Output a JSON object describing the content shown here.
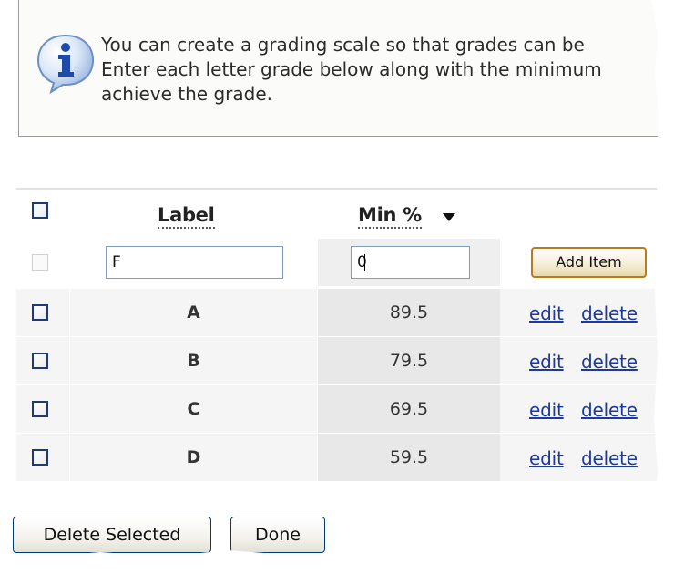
{
  "info": {
    "line1": "You can create a grading scale so that grades can be",
    "line2": "Enter each letter grade below along with the minimum",
    "line3": "achieve the grade.",
    "icon": "info-icon"
  },
  "table": {
    "col_label_header": "Label",
    "col_min_header": "Min %",
    "new_row": {
      "label_value": "F",
      "min_value": "0",
      "add_button": "Add Item"
    },
    "rows": [
      {
        "label": "A",
        "min": "89.5",
        "edit": "edit",
        "delete": "delete"
      },
      {
        "label": "B",
        "min": "79.5",
        "edit": "edit",
        "delete": "delete"
      },
      {
        "label": "C",
        "min": "69.5",
        "edit": "edit",
        "delete": "delete"
      },
      {
        "label": "D",
        "min": "59.5",
        "edit": "edit",
        "delete": "delete"
      }
    ]
  },
  "buttons": {
    "delete_selected": "Delete Selected",
    "done": "Done"
  },
  "colors": {
    "link": "#1d3a9a",
    "checkbox_border": "#1e3a6e",
    "add_button_border": "#b87d17",
    "min_column_shade": "#e8e8e8"
  }
}
